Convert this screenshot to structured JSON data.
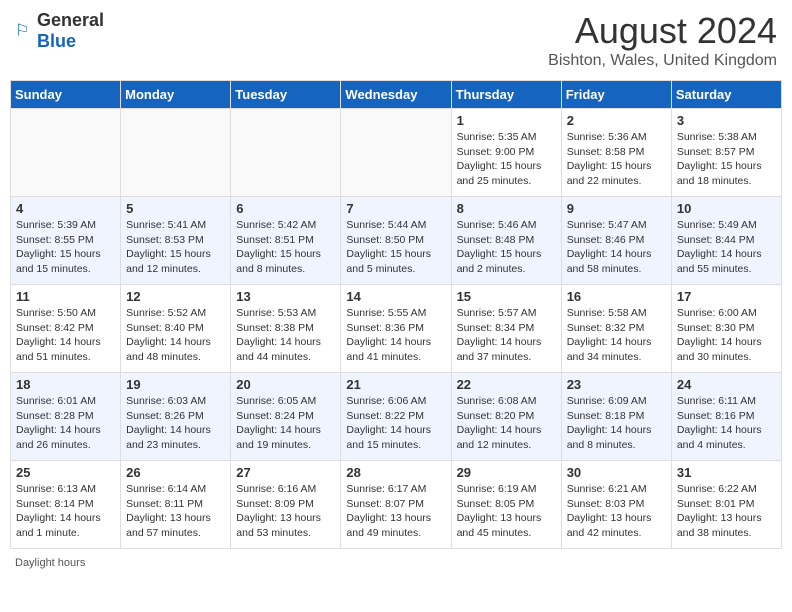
{
  "header": {
    "logo_general": "General",
    "logo_blue": "Blue",
    "month_year": "August 2024",
    "location": "Bishton, Wales, United Kingdom"
  },
  "days_of_week": [
    "Sunday",
    "Monday",
    "Tuesday",
    "Wednesday",
    "Thursday",
    "Friday",
    "Saturday"
  ],
  "footer": {
    "daylight_label": "Daylight hours"
  },
  "weeks": [
    [
      {
        "day": "",
        "content": ""
      },
      {
        "day": "",
        "content": ""
      },
      {
        "day": "",
        "content": ""
      },
      {
        "day": "",
        "content": ""
      },
      {
        "day": "1",
        "content": "Sunrise: 5:35 AM\nSunset: 9:00 PM\nDaylight: 15 hours\nand 25 minutes."
      },
      {
        "day": "2",
        "content": "Sunrise: 5:36 AM\nSunset: 8:58 PM\nDaylight: 15 hours\nand 22 minutes."
      },
      {
        "day": "3",
        "content": "Sunrise: 5:38 AM\nSunset: 8:57 PM\nDaylight: 15 hours\nand 18 minutes."
      }
    ],
    [
      {
        "day": "4",
        "content": "Sunrise: 5:39 AM\nSunset: 8:55 PM\nDaylight: 15 hours\nand 15 minutes."
      },
      {
        "day": "5",
        "content": "Sunrise: 5:41 AM\nSunset: 8:53 PM\nDaylight: 15 hours\nand 12 minutes."
      },
      {
        "day": "6",
        "content": "Sunrise: 5:42 AM\nSunset: 8:51 PM\nDaylight: 15 hours\nand 8 minutes."
      },
      {
        "day": "7",
        "content": "Sunrise: 5:44 AM\nSunset: 8:50 PM\nDaylight: 15 hours\nand 5 minutes."
      },
      {
        "day": "8",
        "content": "Sunrise: 5:46 AM\nSunset: 8:48 PM\nDaylight: 15 hours\nand 2 minutes."
      },
      {
        "day": "9",
        "content": "Sunrise: 5:47 AM\nSunset: 8:46 PM\nDaylight: 14 hours\nand 58 minutes."
      },
      {
        "day": "10",
        "content": "Sunrise: 5:49 AM\nSunset: 8:44 PM\nDaylight: 14 hours\nand 55 minutes."
      }
    ],
    [
      {
        "day": "11",
        "content": "Sunrise: 5:50 AM\nSunset: 8:42 PM\nDaylight: 14 hours\nand 51 minutes."
      },
      {
        "day": "12",
        "content": "Sunrise: 5:52 AM\nSunset: 8:40 PM\nDaylight: 14 hours\nand 48 minutes."
      },
      {
        "day": "13",
        "content": "Sunrise: 5:53 AM\nSunset: 8:38 PM\nDaylight: 14 hours\nand 44 minutes."
      },
      {
        "day": "14",
        "content": "Sunrise: 5:55 AM\nSunset: 8:36 PM\nDaylight: 14 hours\nand 41 minutes."
      },
      {
        "day": "15",
        "content": "Sunrise: 5:57 AM\nSunset: 8:34 PM\nDaylight: 14 hours\nand 37 minutes."
      },
      {
        "day": "16",
        "content": "Sunrise: 5:58 AM\nSunset: 8:32 PM\nDaylight: 14 hours\nand 34 minutes."
      },
      {
        "day": "17",
        "content": "Sunrise: 6:00 AM\nSunset: 8:30 PM\nDaylight: 14 hours\nand 30 minutes."
      }
    ],
    [
      {
        "day": "18",
        "content": "Sunrise: 6:01 AM\nSunset: 8:28 PM\nDaylight: 14 hours\nand 26 minutes."
      },
      {
        "day": "19",
        "content": "Sunrise: 6:03 AM\nSunset: 8:26 PM\nDaylight: 14 hours\nand 23 minutes."
      },
      {
        "day": "20",
        "content": "Sunrise: 6:05 AM\nSunset: 8:24 PM\nDaylight: 14 hours\nand 19 minutes."
      },
      {
        "day": "21",
        "content": "Sunrise: 6:06 AM\nSunset: 8:22 PM\nDaylight: 14 hours\nand 15 minutes."
      },
      {
        "day": "22",
        "content": "Sunrise: 6:08 AM\nSunset: 8:20 PM\nDaylight: 14 hours\nand 12 minutes."
      },
      {
        "day": "23",
        "content": "Sunrise: 6:09 AM\nSunset: 8:18 PM\nDaylight: 14 hours\nand 8 minutes."
      },
      {
        "day": "24",
        "content": "Sunrise: 6:11 AM\nSunset: 8:16 PM\nDaylight: 14 hours\nand 4 minutes."
      }
    ],
    [
      {
        "day": "25",
        "content": "Sunrise: 6:13 AM\nSunset: 8:14 PM\nDaylight: 14 hours\nand 1 minute."
      },
      {
        "day": "26",
        "content": "Sunrise: 6:14 AM\nSunset: 8:11 PM\nDaylight: 13 hours\nand 57 minutes."
      },
      {
        "day": "27",
        "content": "Sunrise: 6:16 AM\nSunset: 8:09 PM\nDaylight: 13 hours\nand 53 minutes."
      },
      {
        "day": "28",
        "content": "Sunrise: 6:17 AM\nSunset: 8:07 PM\nDaylight: 13 hours\nand 49 minutes."
      },
      {
        "day": "29",
        "content": "Sunrise: 6:19 AM\nSunset: 8:05 PM\nDaylight: 13 hours\nand 45 minutes."
      },
      {
        "day": "30",
        "content": "Sunrise: 6:21 AM\nSunset: 8:03 PM\nDaylight: 13 hours\nand 42 minutes."
      },
      {
        "day": "31",
        "content": "Sunrise: 6:22 AM\nSunset: 8:01 PM\nDaylight: 13 hours\nand 38 minutes."
      }
    ]
  ]
}
